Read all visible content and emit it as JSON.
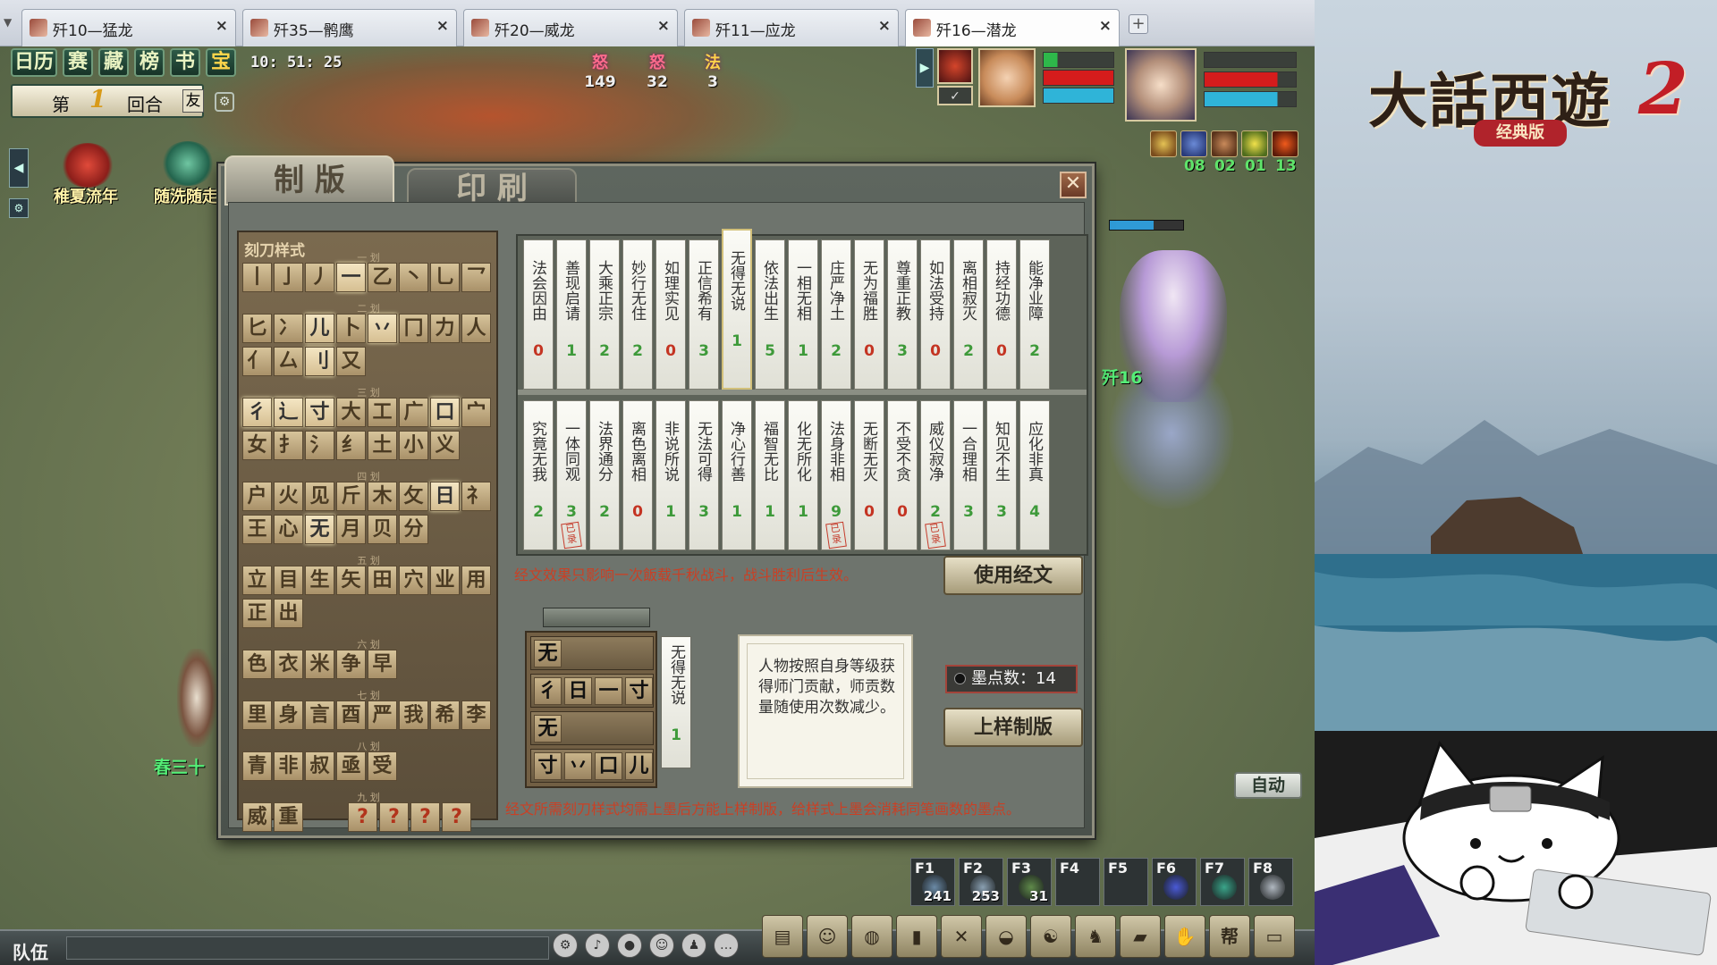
{
  "browser_tabs": [
    {
      "label": "歼10—猛龙",
      "active": false
    },
    {
      "label": "歼35—鹘鹰",
      "active": false
    },
    {
      "label": "歼20—威龙",
      "active": false
    },
    {
      "label": "歼11—应龙",
      "active": false
    },
    {
      "label": "歼16—潜龙",
      "active": true
    }
  ],
  "hud": {
    "buttons": [
      "日历",
      "赛",
      "藏",
      "榜",
      "书",
      "宝"
    ],
    "clock": "10: 51: 25",
    "round": {
      "prefix": "第",
      "number": "1",
      "suffix": "回合",
      "ally": "友"
    },
    "events": [
      {
        "label": "稚夏流年"
      },
      {
        "label": "随洗随走"
      }
    ],
    "rage": [
      {
        "glyph": "怒",
        "value": "149"
      },
      {
        "glyph": "怒",
        "value": "32"
      },
      {
        "glyph": "法",
        "value": "3"
      }
    ],
    "buff_counts": [
      "08",
      "02",
      "01",
      "13"
    ],
    "player_name": "歼16",
    "npc_name": "春三十"
  },
  "dialog": {
    "tabs": {
      "active": "制 版",
      "inactive": "印 刷"
    },
    "close": "✕",
    "stroke_panel": {
      "title": "刻刀样式",
      "sections": [
        {
          "label": "一 划",
          "tiles": [
            "丨",
            "亅",
            "丿",
            "一",
            "乙",
            "丶",
            "乚",
            "乛"
          ]
        },
        {
          "label": "二 划",
          "tiles": [
            "匕",
            "冫",
            "儿",
            "卜",
            "丷",
            "冂",
            "力",
            "人",
            "亻",
            "厶",
            "刂",
            "又"
          ]
        },
        {
          "label": "三 划",
          "tiles": [
            "彳",
            "辶",
            "寸",
            "大",
            "工",
            "广",
            "口",
            "宀",
            "女",
            "扌",
            "氵",
            "纟",
            "土",
            "小",
            "义"
          ]
        },
        {
          "label": "四 划",
          "tiles": [
            "户",
            "火",
            "见",
            "斤",
            "木",
            "攵",
            "日",
            "礻",
            "王",
            "心",
            "无",
            "月",
            "贝",
            "分"
          ]
        },
        {
          "label": "五 划",
          "tiles": [
            "立",
            "目",
            "生",
            "矢",
            "田",
            "穴",
            "业",
            "用",
            "正",
            "出"
          ]
        },
        {
          "label": "六 划",
          "tiles": [
            "色",
            "衣",
            "米",
            "争",
            "早"
          ]
        },
        {
          "label": "七 划",
          "tiles": [
            "里",
            "身",
            "言",
            "酉",
            "严",
            "我",
            "希",
            "李"
          ]
        },
        {
          "label": "八 划",
          "tiles": [
            "青",
            "非",
            "叔",
            "亟",
            "受"
          ]
        },
        {
          "label": "九 划",
          "tiles": [
            "威",
            "重",
            "?",
            "?",
            "?",
            "?"
          ]
        }
      ],
      "extra_label": "? ? ?"
    },
    "sutras_row1": [
      {
        "text": "法会因由",
        "count": "0"
      },
      {
        "text": "善现启请",
        "count": "1"
      },
      {
        "text": "大乘正宗",
        "count": "2"
      },
      {
        "text": "妙行无住",
        "count": "2"
      },
      {
        "text": "如理实见",
        "count": "0"
      },
      {
        "text": "正信希有",
        "count": "3"
      },
      {
        "text": "无得无说",
        "count": "1",
        "selected": true
      },
      {
        "text": "依法出生",
        "count": "5"
      },
      {
        "text": "一相无相",
        "count": "1"
      },
      {
        "text": "庄严净土",
        "count": "2"
      },
      {
        "text": "无为福胜",
        "count": "0"
      },
      {
        "text": "尊重正教",
        "count": "3"
      },
      {
        "text": "如法受持",
        "count": "0"
      },
      {
        "text": "离相寂灭",
        "count": "2"
      },
      {
        "text": "持经功德",
        "count": "0"
      },
      {
        "text": "能净业障",
        "count": "2"
      }
    ],
    "sutras_row2": [
      {
        "text": "究竟无我",
        "count": "2"
      },
      {
        "text": "一体同观",
        "count": "3",
        "stamp": "已录"
      },
      {
        "text": "法界通分",
        "count": "2"
      },
      {
        "text": "离色离相",
        "count": "0"
      },
      {
        "text": "非说所说",
        "count": "1"
      },
      {
        "text": "无法可得",
        "count": "3"
      },
      {
        "text": "净心行善",
        "count": "1"
      },
      {
        "text": "福智无比",
        "count": "1"
      },
      {
        "text": "化无所化",
        "count": "1"
      },
      {
        "text": "法身非相",
        "count": "9",
        "stamp": "已录"
      },
      {
        "text": "无断无灭",
        "count": "0"
      },
      {
        "text": "不受不贪",
        "count": "0"
      },
      {
        "text": "威仪寂净",
        "count": "2",
        "stamp": "已录"
      },
      {
        "text": "一合理相",
        "count": "3"
      },
      {
        "text": "知见不生",
        "count": "3"
      },
      {
        "text": "应化非真",
        "count": "4"
      }
    ],
    "notice_top": "经文效果只影响一次飯载千秋战斗，战斗胜利后生效。",
    "use_sutra_button": "使用经文",
    "plate_rows": [
      [
        "无"
      ],
      [
        "彳",
        "日",
        "一",
        "寸"
      ],
      [
        "无"
      ],
      [
        "寸",
        "丷",
        "口",
        "儿"
      ]
    ],
    "selected_sutra": {
      "text": "无得无说",
      "count": "1"
    },
    "description": "人物按照自身等级获得师门贡献，师贡数量随使用次数减少。",
    "ink": {
      "label": "墨点数：14"
    },
    "plate_button": "上样制版",
    "notice_bottom": "经文所需刻刀样式均需上墨后方能上样制版，给样式上墨会消耗同笔画数的墨点。"
  },
  "bottom": {
    "auto": "自动",
    "team": "队伍",
    "fkeys": [
      {
        "label": "F1",
        "count": "241"
      },
      {
        "label": "F2",
        "count": "253"
      },
      {
        "label": "F3",
        "count": "31"
      },
      {
        "label": "F4",
        "count": ""
      },
      {
        "label": "F5",
        "count": ""
      },
      {
        "label": "F6",
        "count": ""
      },
      {
        "label": "F7",
        "count": ""
      },
      {
        "label": "F8",
        "count": ""
      }
    ]
  },
  "overlay": {
    "logo_main": "大話西遊",
    "logo_num": "2",
    "logo_sub": "经典版"
  }
}
